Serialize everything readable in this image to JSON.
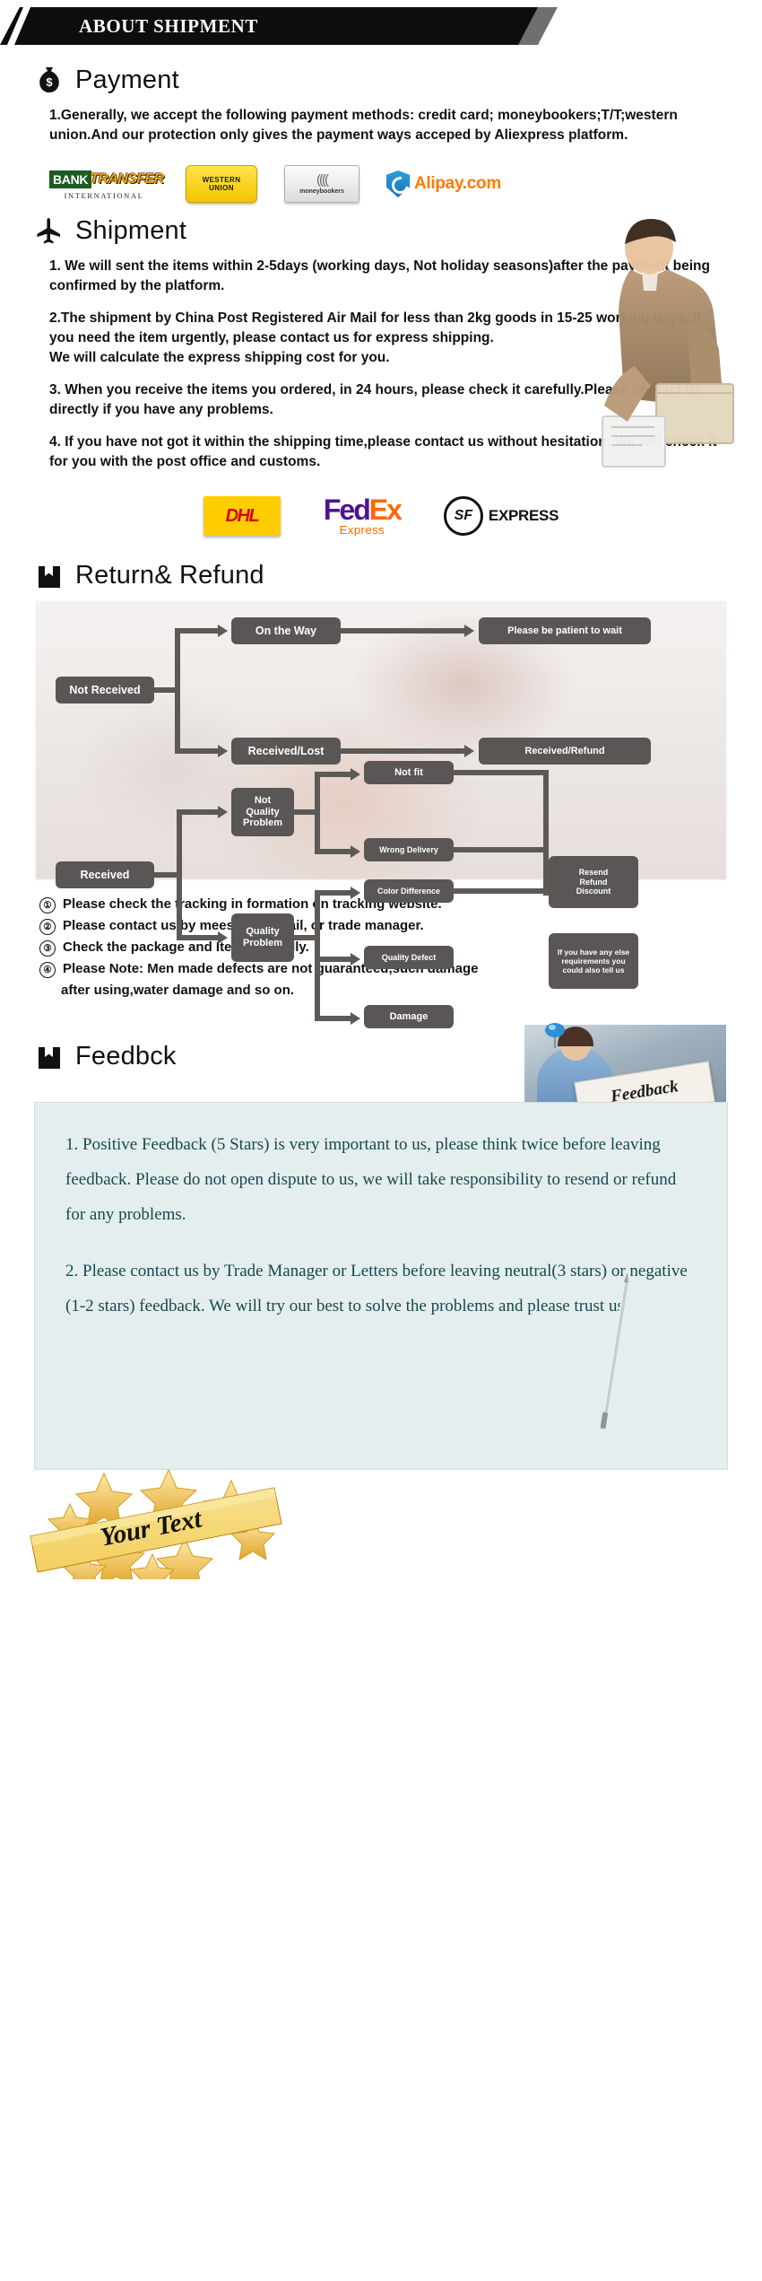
{
  "banner": {
    "title": "ABOUT SHIPMENT"
  },
  "payment": {
    "heading": "Payment",
    "icon": "money-bag-icon",
    "text": "1.Generally, we accept the following payment methods: credit card; moneybookers;T/T;western union.And our protection only gives the payment ways acceped by Aliexpress platform.",
    "logos": [
      {
        "name": "bank-transfer-logo",
        "line1a": "BANK",
        "line1b": "TRANSFER",
        "line2": "INTERNATIONAL"
      },
      {
        "name": "western-union-logo",
        "line1": "WESTERN",
        "line2": "UNION"
      },
      {
        "name": "moneybookers-logo",
        "label": "moneybookers"
      },
      {
        "name": "alipay-logo",
        "label": "Alipay.com"
      }
    ]
  },
  "shipment": {
    "heading": "Shipment",
    "icon": "airplane-icon",
    "paragraphs": [
      "1. We will sent the items within 2-5days (working days, Not holiday seasons)after the payment being confirmed by the platform.",
      "2.The shipment by China Post Registered Air Mail for less than  2kg goods in 15-25 working days, If  you need the item urgently, please contact us for express shipping.",
      "We will calculate the express shipping cost for you.",
      "3. When you receive the items you ordered, in 24 hours, please check  it carefully.Please contact us directly if you have any problems.",
      "4. If you have not got it within the shipping time,please contact us without hesitation. We will check it for you with the post office and customs."
    ],
    "carriers": [
      {
        "name": "dhl-logo",
        "label": "DHL"
      },
      {
        "name": "fedex-logo",
        "label_a": "Fed",
        "label_b": "Ex",
        "label_reg": "®",
        "sub": "Express"
      },
      {
        "name": "sf-express-logo",
        "mark": "SF",
        "label": "EXPRESS"
      }
    ]
  },
  "returns": {
    "heading": "Return& Refund",
    "icon": "return-box-icon",
    "flow": {
      "not_received": "Not Received",
      "on_the_way": "On the Way",
      "received_lost": "Received/Lost",
      "be_patient": "Please be patient to wait",
      "received_refund": "Received/Refund",
      "received": "Received",
      "not_quality_problem": "Not\nQuality\nProblem",
      "quality_problem": "Quality\nProblem",
      "not_fit": "Not fit",
      "wrong_delivery": "Wrong Delivery",
      "color_difference": "Color Difference",
      "quality_defect": "Quality Defect",
      "damage": "Damage",
      "resend_refund_discount": "Resend\nRefund\nDiscount",
      "else_requirements": "If you have any else\nrequirements you\ncould also tell us"
    },
    "notes": [
      {
        "num": "①",
        "text": "Please check the tracking in formation on tracking website."
      },
      {
        "num": "②",
        "text": "Please contact us by meesage, e-mail, or trade manager."
      },
      {
        "num": "③",
        "text": "Check the package and Item, carefully."
      },
      {
        "num": "④",
        "text": "Please Note: Men made defects  are not guaranteed,such damage"
      }
    ],
    "notes_tail": "after using,water damage and so on."
  },
  "feedback": {
    "heading": "Feedbck",
    "icon": "feedback-box-icon",
    "photo_card_label": "Feedback",
    "paragraphs": [
      "1. Positive Feedback (5 Stars) is very important to us, please think twice before leaving feedback. Please do not open dispute to us,   we will take responsibility to resend or refund for any problems.",
      "2. Please contact us by Trade Manager or Letters before leaving neutral(3 stars) or negative (1-2 stars) feedback. We will try our best to solve the problems and please trust us"
    ]
  },
  "ribbon": {
    "text": "Your Text"
  },
  "colors": {
    "banner_bg": "#0d0d0d",
    "node_gray": "#595655",
    "feedback_panel": "#e4eeee",
    "feedback_text": "#17484f",
    "dhl_yellow": "#ffcc00",
    "dhl_red": "#d40511",
    "fedex_purple": "#4d148c",
    "fedex_orange": "#ff6600",
    "alipay_orange": "#ff7a00",
    "ribbon_gold": "#e8b733"
  }
}
